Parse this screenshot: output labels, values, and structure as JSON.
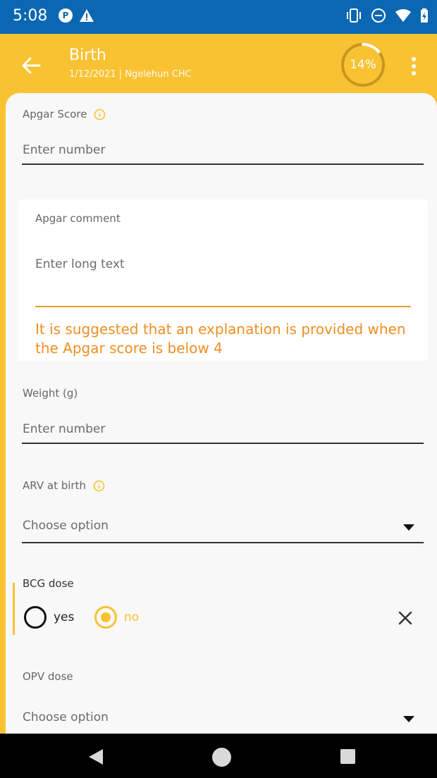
{
  "status_bar": {
    "time": "5:08",
    "left_icons": [
      "data-saver-icon",
      "warning-icon"
    ],
    "right_icons": [
      "vibrate-icon",
      "do-not-disturb-icon",
      "wifi-icon",
      "battery-charging-icon"
    ]
  },
  "app_bar": {
    "title": "Birth",
    "date": "1/12/2021",
    "org_unit": "Ngelehun CHC",
    "progress_label": "14%",
    "progress_fraction": 0.14
  },
  "form": {
    "apgar_score": {
      "label": "Apgar Score",
      "placeholder": "Enter number"
    },
    "apgar_comment": {
      "label": "Apgar comment",
      "placeholder": "Enter long text",
      "warning": "It is suggested that an explanation is provided when the Apgar score is below 4"
    },
    "weight": {
      "label": "Weight (g)",
      "placeholder": "Enter number"
    },
    "arv_at_birth": {
      "label": "ARV at birth",
      "placeholder": "Choose option"
    },
    "bcg_dose": {
      "label": "BCG dose",
      "options": [
        "yes",
        "no"
      ],
      "selected": "no"
    },
    "opv_dose": {
      "label": "OPV dose",
      "placeholder": "Choose option"
    }
  },
  "colors": {
    "primary": "#f9c232",
    "status_bar": "#0b67b2",
    "warning": "#ef8e21"
  }
}
